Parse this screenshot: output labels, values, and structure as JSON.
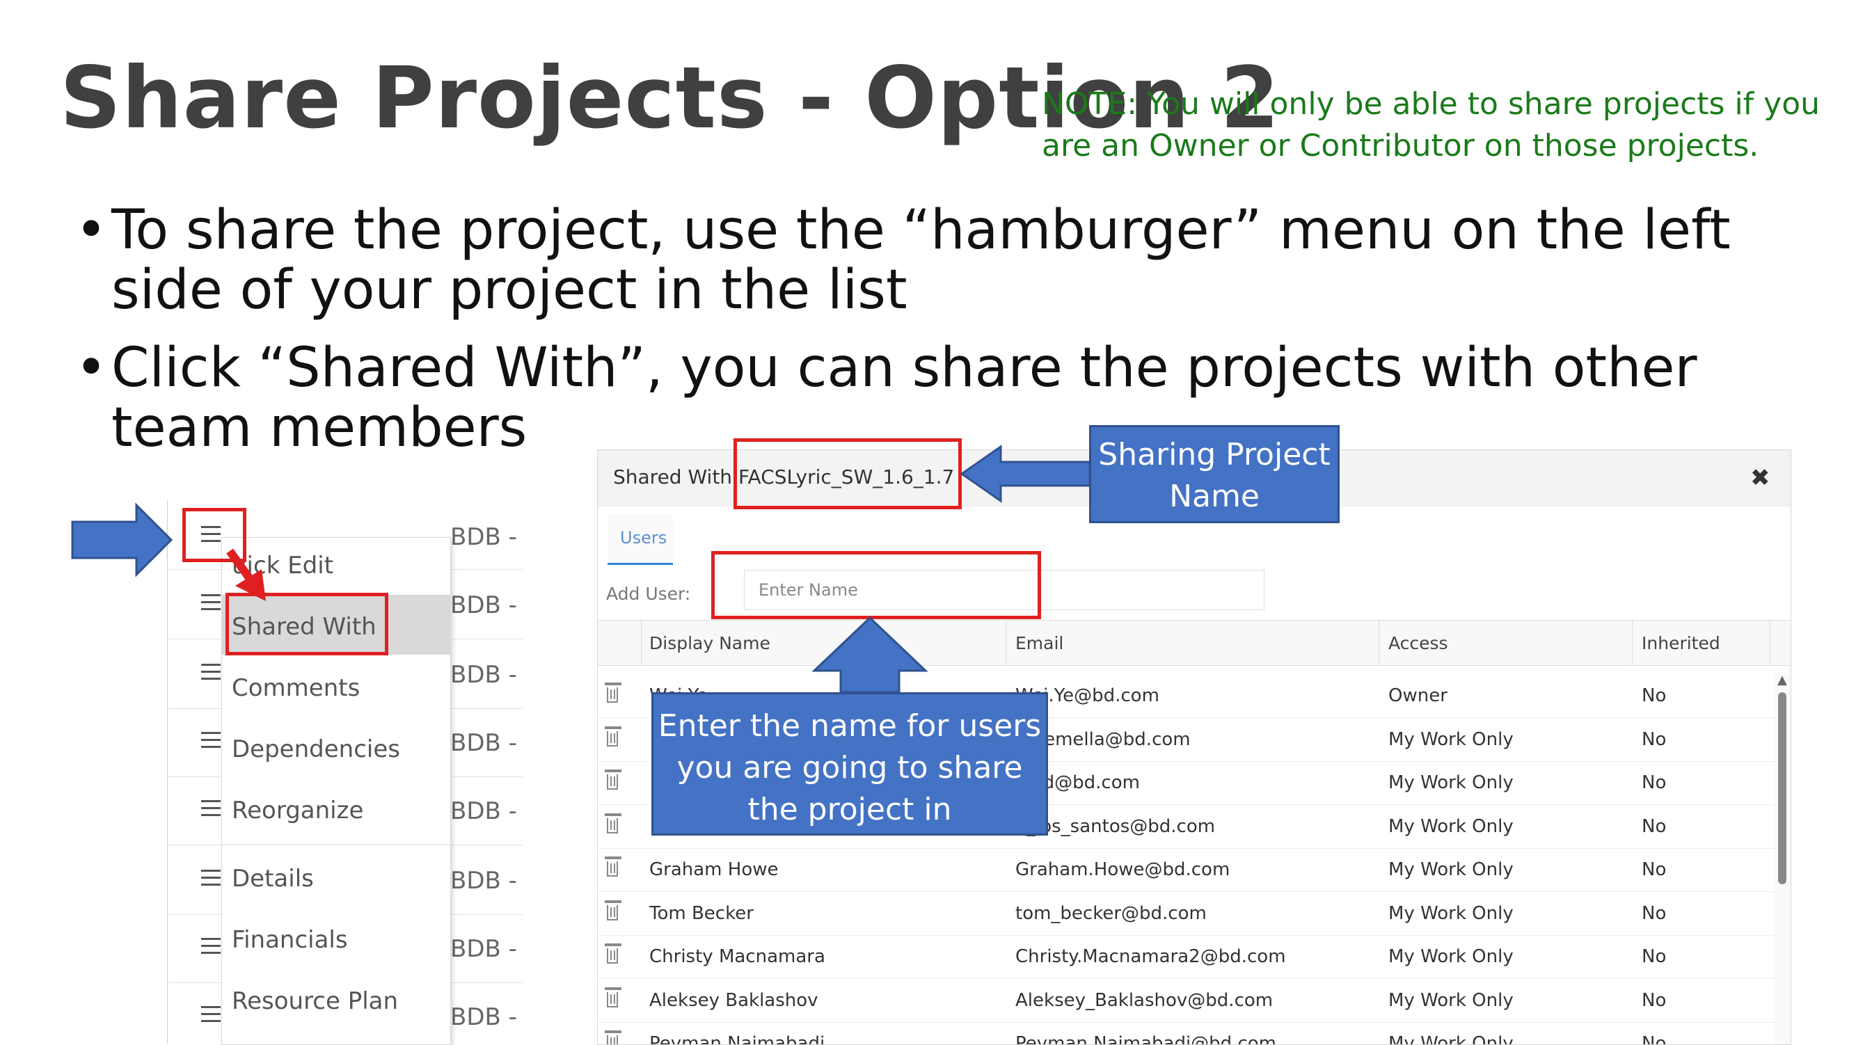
{
  "slide": {
    "title": "Share Projects - Option 2",
    "note": "NOTE: You will only be able to share projects if you are an Owner or Contributor on those projects.",
    "bullets": [
      "To share the project, use the “hamburger” menu on the left side of your project in the list",
      "Click “Shared With”, you can share the projects with other team members"
    ],
    "bullet_glyph": "•"
  },
  "menu": {
    "row_prefix": "BDB -",
    "items": [
      {
        "label": "Quick Edit",
        "visible_label": "uick Edit"
      },
      {
        "label": "Shared With"
      },
      {
        "label": "Comments"
      },
      {
        "label": "Dependencies"
      },
      {
        "label": "Reorganize"
      },
      {
        "label": "Details"
      },
      {
        "label": "Financials"
      },
      {
        "label": "Resource Plan"
      }
    ]
  },
  "dialog": {
    "title_label": "Shared With:",
    "project_name": "FACSLyric_SW_1.6_1.7",
    "close_glyph": "✖",
    "tab_users": "Users",
    "add_user_label": "Add User:",
    "add_user_placeholder": "Enter Name",
    "columns": {
      "display_name": "Display Name",
      "email": "Email",
      "access": "Access",
      "inherited": "Inherited"
    },
    "rows": [
      {
        "name": "Wei Ye",
        "email": "Wei.Ye@bd.com",
        "access": "Owner",
        "inherited": "No"
      },
      {
        "name": "",
        "email": "a.Remella@bd.com",
        "access": "My Work Only",
        "inherited": "No"
      },
      {
        "name": "",
        "email": "bold@bd.com",
        "access": "My Work Only",
        "inherited": "No"
      },
      {
        "name": "",
        "email": "e_los_santos@bd.com",
        "access": "My Work Only",
        "inherited": "No"
      },
      {
        "name": "Graham Howe",
        "email": "Graham.Howe@bd.com",
        "access": "My Work Only",
        "inherited": "No"
      },
      {
        "name": "Tom Becker",
        "email": "tom_becker@bd.com",
        "access": "My Work Only",
        "inherited": "No"
      },
      {
        "name": "Christy Macnamara",
        "email": "Christy.Macnamara2@bd.com",
        "access": "My Work Only",
        "inherited": "No"
      },
      {
        "name": "Aleksey Baklashov",
        "email": "Aleksey_Baklashov@bd.com",
        "access": "My Work Only",
        "inherited": "No"
      },
      {
        "name": "Peyman Najmabadi",
        "email": "Peyman.Najmabadi@bd.com",
        "access": "My Work Only",
        "inherited": "No"
      }
    ]
  },
  "callouts": {
    "sharing_project_name": "Sharing Project Name",
    "enter_name": "Enter the name for users you are going to share the project in"
  },
  "colors": {
    "callout_blue": "#4472c4",
    "highlight_red": "#e02020",
    "note_green": "#1a7a1a",
    "tab_accent": "#2a86e0"
  }
}
